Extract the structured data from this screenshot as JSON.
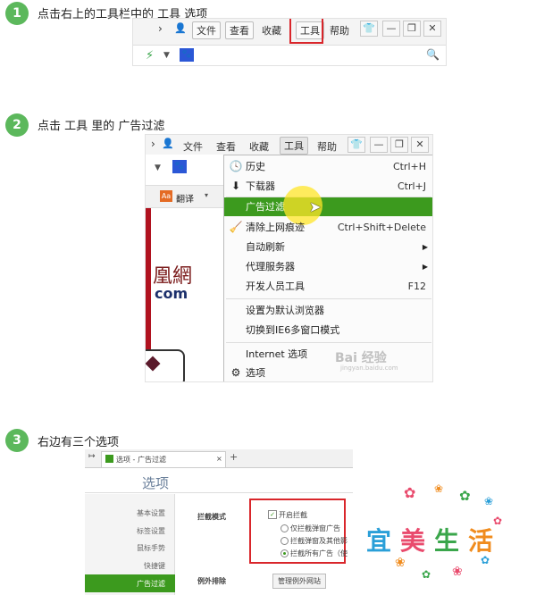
{
  "steps": [
    {
      "num": "1",
      "text": "点击右上的工具栏中的 工具 选项"
    },
    {
      "num": "2",
      "text": "点击 工具 里的 广告过滤"
    },
    {
      "num": "3",
      "text": "右边有三个选项"
    }
  ],
  "toolbar": {
    "file": "文件",
    "view": "查看",
    "favorites": "收藏",
    "tools": "工具",
    "help": "帮助",
    "shirt_icon": "tshirt-icon",
    "minimize": "—",
    "restore": "❐",
    "close": "✕"
  },
  "shot2": {
    "translate": "翻译",
    "logo_text": "凰網",
    "logo_domain": "com"
  },
  "tools_menu": {
    "items": [
      {
        "label": "历史",
        "shortcut": "Ctrl+H",
        "icon": "clock-icon"
      },
      {
        "label": "下载器",
        "shortcut": "Ctrl+J",
        "icon": "download-icon"
      },
      {
        "label": "广告过滤",
        "shortcut": "",
        "icon": ""
      },
      {
        "label": "清除上网痕迹",
        "shortcut": "Ctrl+Shift+Delete",
        "icon": "eraser-icon"
      },
      {
        "label": "自动刷新",
        "shortcut": "",
        "icon": ""
      },
      {
        "label": "代理服务器",
        "shortcut": "",
        "icon": ""
      },
      {
        "label": "开发人员工具",
        "shortcut": "F12",
        "icon": ""
      },
      {
        "label": "设置为默认浏览器",
        "shortcut": "",
        "icon": ""
      },
      {
        "label": "切换到IE6多窗口模式",
        "shortcut": "",
        "icon": ""
      },
      {
        "label": "Internet 选项",
        "shortcut": "",
        "icon": ""
      },
      {
        "label": "选项",
        "shortcut": "",
        "icon": "gear-icon"
      }
    ],
    "highlight_color": "#3c9a1e"
  },
  "watermark": {
    "text": "Bai 经验",
    "sub": "jingyan.baidu.com"
  },
  "options_window": {
    "tab_title": "选项 - 广告过滤",
    "heading": "选项",
    "sidebar": [
      "基本设置",
      "标签设置",
      "鼠标手势",
      "快捷键",
      "广告过滤"
    ],
    "block_mode_label": "拦截模式",
    "enable_block": "开启拦截",
    "radio_options": [
      "仅拦截弹窗广告",
      "拦截弹窗及其他影",
      "拦截所有广告（使"
    ],
    "exceptions_label": "例外排除",
    "manage_button": "管理例外网站"
  },
  "logo": {
    "chars": [
      "宜",
      "美",
      "生",
      "活"
    ],
    "colors": [
      "#2a9fd8",
      "#e94b6d",
      "#3aa64b",
      "#f08c1e"
    ]
  }
}
